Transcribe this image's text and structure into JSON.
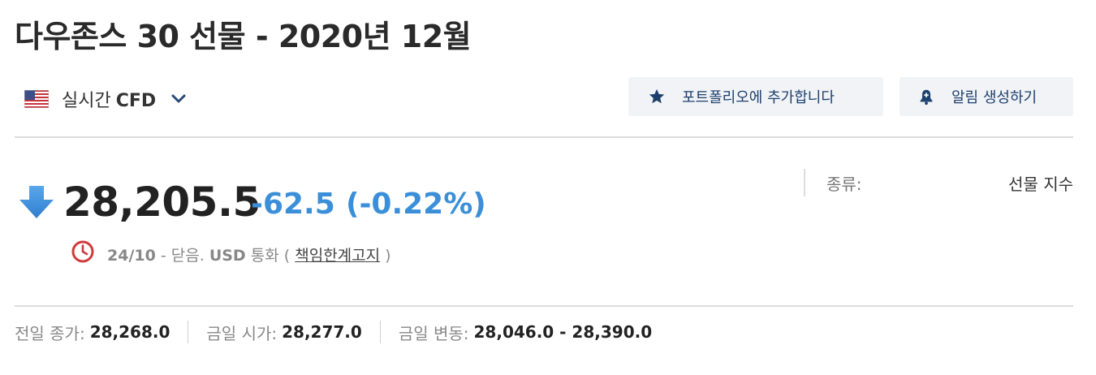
{
  "header": {
    "title": "다우존스 30 선물 - 2020년 12월"
  },
  "market": {
    "flag_icon": "us-flag-icon",
    "label": "실시간",
    "label_bold": "CFD",
    "dropdown_icon": "chevron-down-icon"
  },
  "actions": {
    "portfolio": {
      "label": "포트폴리오에 추가합니다",
      "icon": "star-icon"
    },
    "alert": {
      "label": "알림 생성하기",
      "icon": "bell-icon"
    }
  },
  "quote": {
    "direction_icon": "arrow-down-icon",
    "price": "28,205.5",
    "change": "-62.5",
    "change_percent": "(-0.22%)",
    "change_color": "#3b8fd9"
  },
  "status": {
    "clock_icon": "clock-icon",
    "date": "24/10",
    "separator": " - ",
    "state": "닫음.",
    "currency": "USD",
    "currency_text": "통화",
    "paren_open": "(",
    "disclaimer_link": "책임한계고지",
    "paren_close": ")"
  },
  "info": {
    "type_label": "종류:",
    "type_value": "선물 지수"
  },
  "stats": [
    {
      "label": "전일 종가:",
      "value": "28,268.0"
    },
    {
      "label": "금일 시가:",
      "value": "28,277.0"
    },
    {
      "label": "금일 변동:",
      "value": "28,046.0 - 28,390.0"
    }
  ]
}
